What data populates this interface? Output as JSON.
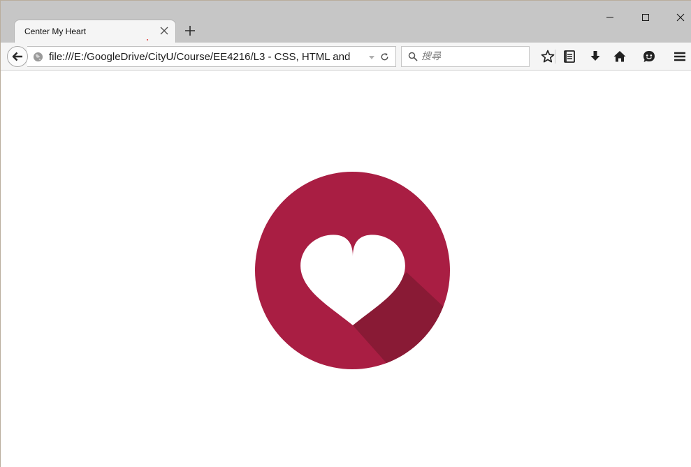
{
  "tab": {
    "title": "Center My Heart"
  },
  "urlbar": {
    "url": "file:///E:/GoogleDrive/CityU/Course/EE4216/L3 - CSS, HTML and"
  },
  "search": {
    "placeholder": "搜尋"
  },
  "colors": {
    "heart_circle": "#a91e43",
    "heart_shadow": "#891a35",
    "heart": "#ffffff",
    "icon": "#1a1a1a"
  }
}
